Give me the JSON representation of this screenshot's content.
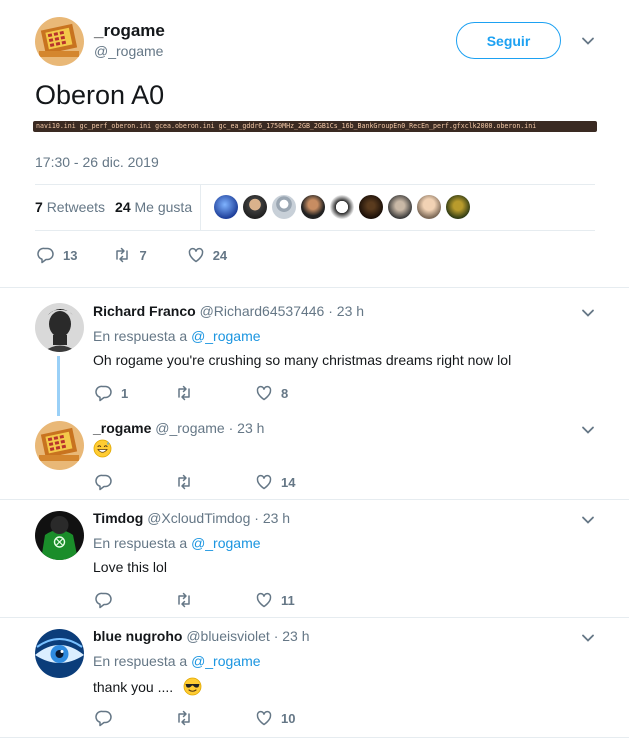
{
  "main_tweet": {
    "author_name": "_rogame",
    "author_handle": "@_rogame",
    "follow_label": "Seguir",
    "text": "Oberon A0",
    "image_text": "navi10.ini gc_perf_oberon.ini gcea.oberon.ini gc_ea_gddr6_1750MHz_2GB_2GB1Cs_16b_BankGroupEn0_RecEn_perf.gfxclk2000.oberon.ini",
    "timestamp": "17:30 - 26 dic. 2019",
    "retweets_count": "7",
    "retweets_label": "Retweets",
    "likes_count": "24",
    "likes_label": "Me gusta",
    "actions": {
      "replies": "13",
      "retweets": "7",
      "likes": "24"
    }
  },
  "replies": [
    {
      "name": "Richard Franco",
      "handle": "@Richard64537446",
      "time": "· 23 h",
      "reply_prefix": "En respuesta a",
      "reply_to": "@_rogame",
      "text": "Oh rogame you're crushing so many christmas dreams right now lol",
      "replies": "1",
      "retweets": "",
      "likes": "8"
    },
    {
      "name": "_rogame",
      "handle": "@_rogame",
      "time": "· 23 h",
      "text": "",
      "replies": "",
      "retweets": "",
      "likes": "14"
    },
    {
      "name": "Timdog",
      "handle": "@XcloudTimdog",
      "time": "· 23 h",
      "reply_prefix": "En respuesta a",
      "reply_to": "@_rogame",
      "text": "Love this lol",
      "replies": "",
      "retweets": "",
      "likes": "11"
    },
    {
      "name": "blue nugroho",
      "handle": "@blueisviolet",
      "time": "· 23 h",
      "reply_prefix": "En respuesta a",
      "reply_to": "@_rogame",
      "text": "thank you ....",
      "replies": "",
      "retweets": "",
      "likes": "10"
    }
  ],
  "icons": {
    "reply": "reply-icon",
    "retweet": "retweet-icon",
    "like": "heart-icon",
    "more": "chevron-down-icon",
    "emoji_sweat": "grinning-sweat-emoji",
    "emoji_sunglasses": "sunglasses-emoji"
  },
  "colors": {
    "accent": "#1da1f2",
    "link": "#1b95e0",
    "muted": "#657786",
    "divider": "#e6ecf0",
    "thread_line": "#9ad0f7"
  }
}
